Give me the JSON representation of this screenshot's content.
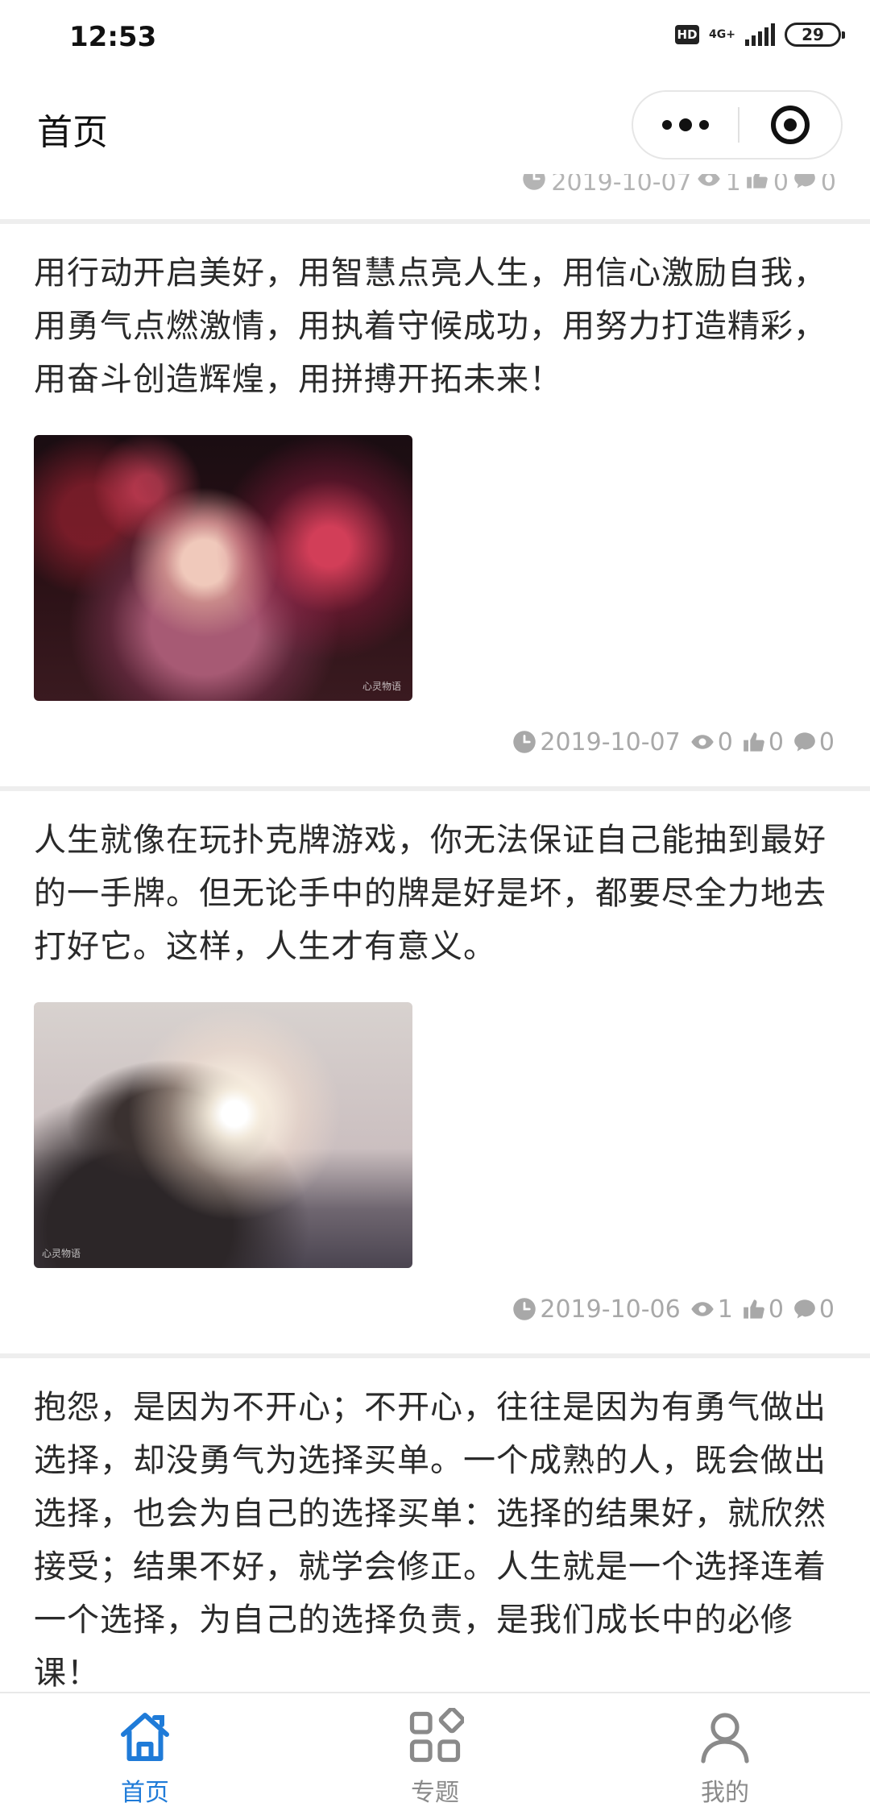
{
  "status_bar": {
    "time": "12:53",
    "hd": "HD",
    "network": "4G+",
    "battery": "29"
  },
  "nav": {
    "title": "首页"
  },
  "partial_post_meta": {
    "date": "2019-10-07",
    "views": "1",
    "likes": "0",
    "comments": "0"
  },
  "posts": [
    {
      "text": "用行动开启美好，用智慧点亮人生，用信心激励自我，用勇气点燃激情，用执着守候成功，用努力打造精彩，用奋斗创造辉煌，用拼搏开拓未来！",
      "image_watermark": "心灵物语",
      "date": "2019-10-07",
      "views": "0",
      "likes": "0",
      "comments": "0"
    },
    {
      "text": "人生就像在玩扑克牌游戏，你无法保证自己能抽到最好的一手牌。但无论手中的牌是好是坏，都要尽全力地去打好它。这样，人生才有意义。",
      "image_watermark": "心灵物语",
      "date": "2019-10-06",
      "views": "1",
      "likes": "0",
      "comments": "0"
    },
    {
      "text": "抱怨，是因为不开心；不开心，往往是因为有勇气做出选择，却没勇气为选择买单。一个成熟的人，既会做出选择，也会为自己的选择买单：选择的结果好，就欣然接受；结果不好，就学会修正。人生就是一个选择连着一个选择，为自己的选择负责，是我们成长中的必修课！"
    }
  ],
  "tabs": [
    {
      "label": "首页",
      "icon": "home-icon",
      "active": true
    },
    {
      "label": "专题",
      "icon": "apps-icon",
      "active": false
    },
    {
      "label": "我的",
      "icon": "user-icon",
      "active": false
    }
  ],
  "colors": {
    "accent": "#1f7bd8",
    "meta_text": "#a8a8a8",
    "separator": "#eeeeee"
  }
}
